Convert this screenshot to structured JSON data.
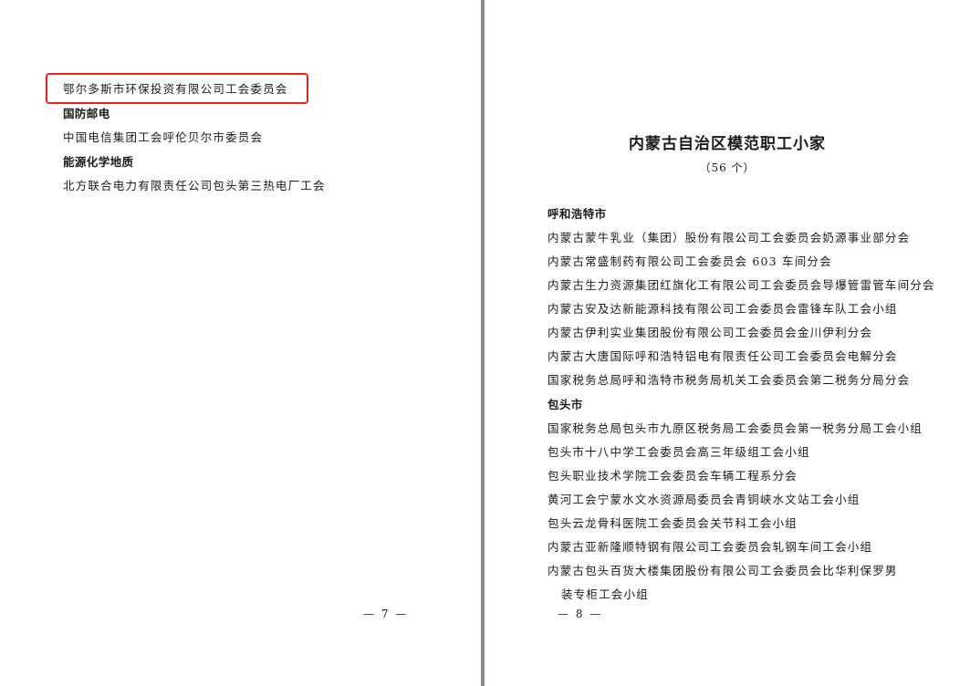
{
  "left_page": {
    "highlighted_entry": "鄂尔多斯市环保投资有限公司工会委员会",
    "sections": [
      {
        "heading": "国防邮电",
        "entries": [
          "中国电信集团工会呼伦贝尔市委员会"
        ]
      },
      {
        "heading": "能源化学地质",
        "entries": [
          "北方联合电力有限责任公司包头第三热电厂工会"
        ]
      }
    ],
    "page_number": "— 7 —"
  },
  "right_page": {
    "title": "内蒙古自治区模范职工小家",
    "count": "（56 个）",
    "sections": [
      {
        "heading": "呼和浩特市",
        "entries": [
          "内蒙古蒙牛乳业（集团）股份有限公司工会委员会奶源事业部分会",
          "内蒙古常盛制药有限公司工会委员会 603 车间分会",
          "内蒙古生力资源集团红旗化工有限公司工会委员会导爆管雷管车间分会",
          "内蒙古安及达新能源科技有限公司工会委员会雷锋车队工会小组",
          "内蒙古伊利实业集团股份有限公司工会委员会金川伊利分会",
          "内蒙古大唐国际呼和浩特铝电有限责任公司工会委员会电解分会",
          "国家税务总局呼和浩特市税务局机关工会委员会第二税务分局分会"
        ]
      },
      {
        "heading": "包头市",
        "entries": [
          "国家税务总局包头市九原区税务局工会委员会第一税务分局工会小组",
          "包头市十八中学工会委员会高三年级组工会小组",
          "包头职业技术学院工会委员会车辆工程系分会",
          "黄河工会宁蒙水文水资源局委员会青铜峡水文站工会小组",
          "包头云龙骨科医院工会委员会关节科工会小组",
          "内蒙古亚新隆顺特钢有限公司工会委员会轧钢车间工会小组",
          "内蒙古包头百货大楼集团股份有限公司工会委员会比华利保罗男"
        ],
        "continuation": "装专柜工会小组"
      }
    ],
    "page_number": "— 8 —"
  },
  "colors": {
    "highlight_border": "#e8231f",
    "page_background": "#ffffff",
    "gutter": "#8a8a8a"
  }
}
